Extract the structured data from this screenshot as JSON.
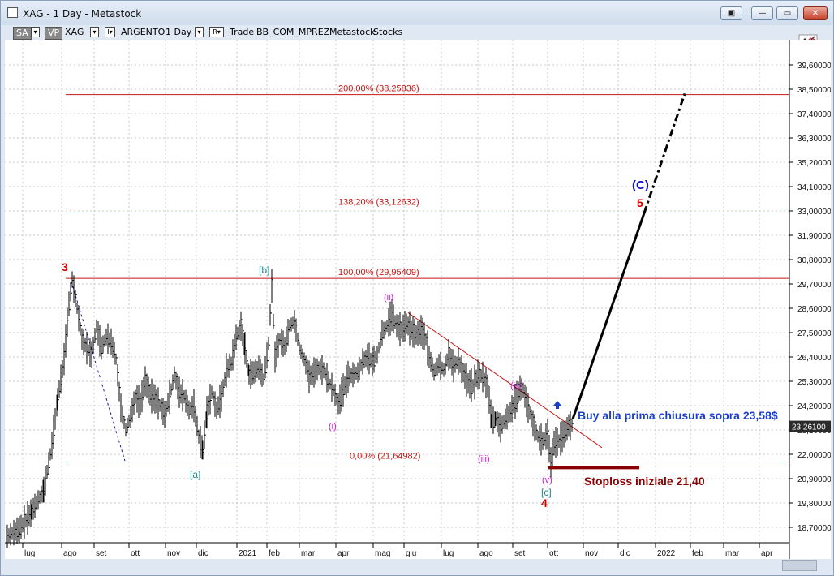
{
  "window": {
    "title": "XAG - 1 Day - Metastock",
    "buttons": {
      "options": "▣",
      "minimize": "—",
      "restore": "▭",
      "close": "✕"
    }
  },
  "toolbar": {
    "sa_label": "SA",
    "vp_label": "VP",
    "symbol": "XAG",
    "items": [
      "ARGENTO",
      "1 Day",
      "Trade",
      "BB_COM_MPREZ",
      "Metastock",
      "Stocks"
    ],
    "dropdown_glyph": "▾",
    "r_label": "R▾",
    "i_label": "I▾"
  },
  "icons": {
    "app": "window-icon",
    "toolbar_right": "chart-tools-icon"
  },
  "colors": {
    "price": "#000000",
    "fib": "#c81414",
    "wave_red": "#d00000",
    "wave_teal": "#208a8a",
    "wave_magenta": "#d020d0",
    "wave_blue": "#1010c0",
    "stoploss": "#8b0000",
    "last_price_bg": "#2b2b2b"
  },
  "chart_data": {
    "type": "line",
    "title": "XAG - 1 Day - Metastock",
    "price_axis_labels": [
      "39,60000",
      "38,50000",
      "37,40000",
      "36,30000",
      "35,20000",
      "34,10000",
      "33,00000",
      "31,90000",
      "30,80000",
      "29,70000",
      "28,60000",
      "27,50000",
      "26,40000",
      "25,30000",
      "24,20000",
      "23,10000",
      "22,00000",
      "20,90000",
      "19,80000",
      "18,70000"
    ],
    "last_price": "23,26100",
    "time_axis_labels": [
      "lug",
      "ago",
      "set",
      "ott",
      "nov",
      "dic",
      "2021",
      "feb",
      "mar",
      "apr",
      "mag",
      "giu",
      "lug",
      "ago",
      "set",
      "ott",
      "nov",
      "dic",
      "2022",
      "feb",
      "mar",
      "apr"
    ],
    "ylim": [
      18.0,
      40.5
    ],
    "fib_levels": [
      {
        "label": "200,00% (38,25836)",
        "value": 38.25836
      },
      {
        "label": "138,20% (33,12632)",
        "value": 33.12632
      },
      {
        "label": "100,00% (29,95409)",
        "value": 29.95409
      },
      {
        "label": "0,00% (21,64982)",
        "value": 21.64982
      }
    ],
    "price_path": [
      [
        0,
        18.3
      ],
      [
        15,
        18.6
      ],
      [
        30,
        19.4
      ],
      [
        45,
        20.4
      ],
      [
        55,
        22.4
      ],
      [
        62,
        24.5
      ],
      [
        70,
        26.3
      ],
      [
        76,
        28.8
      ],
      [
        80,
        29.9
      ],
      [
        86,
        28.6
      ],
      [
        92,
        27.2
      ],
      [
        98,
        26.8
      ],
      [
        104,
        26.5
      ],
      [
        110,
        27.8
      ],
      [
        116,
        26.8
      ],
      [
        122,
        27.3
      ],
      [
        128,
        27.1
      ],
      [
        134,
        26.3
      ],
      [
        140,
        24.1
      ],
      [
        146,
        23.1
      ],
      [
        152,
        23.7
      ],
      [
        158,
        24.6
      ],
      [
        164,
        24.3
      ],
      [
        170,
        25.3
      ],
      [
        176,
        24.7
      ],
      [
        182,
        24.5
      ],
      [
        188,
        24.2
      ],
      [
        194,
        23.8
      ],
      [
        200,
        24.6
      ],
      [
        206,
        25.6
      ],
      [
        212,
        24.8
      ],
      [
        218,
        24.6
      ],
      [
        224,
        24.0
      ],
      [
        230,
        24.2
      ],
      [
        236,
        22.8
      ],
      [
        241,
        22.2
      ],
      [
        246,
        23.9
      ],
      [
        252,
        24.8
      ],
      [
        258,
        24.0
      ],
      [
        264,
        24.6
      ],
      [
        270,
        25.8
      ],
      [
        276,
        26.1
      ],
      [
        282,
        27.3
      ],
      [
        288,
        27.8
      ],
      [
        293,
        26.8
      ],
      [
        298,
        25.6
      ],
      [
        304,
        25.7
      ],
      [
        310,
        25.9
      ],
      [
        316,
        25.4
      ],
      [
        322,
        27.0
      ],
      [
        326,
        29.6
      ],
      [
        330,
        26.4
      ],
      [
        336,
        27.2
      ],
      [
        342,
        26.9
      ],
      [
        348,
        27.8
      ],
      [
        354,
        28.0
      ],
      [
        360,
        26.8
      ],
      [
        366,
        26.3
      ],
      [
        372,
        25.5
      ],
      [
        378,
        25.7
      ],
      [
        384,
        25.9
      ],
      [
        390,
        25.8
      ],
      [
        396,
        25.3
      ],
      [
        402,
        24.9
      ],
      [
        408,
        24.3
      ],
      [
        414,
        24.9
      ],
      [
        420,
        25.5
      ],
      [
        426,
        25.6
      ],
      [
        432,
        25.7
      ],
      [
        438,
        26.2
      ],
      [
        444,
        26.4
      ],
      [
        450,
        26.2
      ],
      [
        456,
        26.5
      ],
      [
        462,
        27.5
      ],
      [
        468,
        27.8
      ],
      [
        474,
        28.3
      ],
      [
        480,
        27.8
      ],
      [
        486,
        27.6
      ],
      [
        492,
        27.9
      ],
      [
        498,
        27.6
      ],
      [
        504,
        27.4
      ],
      [
        510,
        27.6
      ],
      [
        516,
        27.2
      ],
      [
        520,
        26.4
      ],
      [
        526,
        25.7
      ],
      [
        532,
        26.1
      ],
      [
        538,
        25.8
      ],
      [
        544,
        26.5
      ],
      [
        550,
        26.0
      ],
      [
        556,
        26.2
      ],
      [
        562,
        25.7
      ],
      [
        568,
        25.2
      ],
      [
        574,
        25.1
      ],
      [
        580,
        25.6
      ],
      [
        586,
        25.5
      ],
      [
        592,
        25.1
      ],
      [
        597,
        23.5
      ],
      [
        602,
        23.6
      ],
      [
        608,
        23.2
      ],
      [
        614,
        23.6
      ],
      [
        620,
        23.9
      ],
      [
        626,
        24.4
      ],
      [
        632,
        25.0
      ],
      [
        636,
        24.9
      ],
      [
        642,
        24.1
      ],
      [
        648,
        23.4
      ],
      [
        654,
        22.8
      ],
      [
        660,
        22.6
      ],
      [
        666,
        22.9
      ],
      [
        670,
        21.6
      ],
      [
        674,
        22.5
      ],
      [
        680,
        22.6
      ],
      [
        686,
        22.9
      ],
      [
        692,
        23.3
      ],
      [
        696,
        23.3
      ]
    ],
    "trendline": [
      [
        497,
        28.4
      ],
      [
        736,
        22.3
      ]
    ],
    "projection_solid": [
      [
        700,
        23.6
      ],
      [
        788,
        32.9
      ]
    ],
    "projection_dashed": [
      [
        788,
        32.9
      ],
      [
        838,
        38.3
      ]
    ],
    "dashed_fall": [
      [
        82,
        29.8
      ],
      [
        148,
        21.7
      ]
    ],
    "stoploss_line": {
      "value": 21.4,
      "x_start": 670,
      "x_end": 782
    },
    "wave_labels": [
      {
        "text": "3",
        "color": "red"
      },
      {
        "text": "[b]",
        "color": "teal"
      },
      {
        "text": "[a]",
        "color": "teal"
      },
      {
        "text": "(ii)",
        "color": "magenta"
      },
      {
        "text": "(i)",
        "color": "magenta"
      },
      {
        "text": "(iv)",
        "color": "magenta"
      },
      {
        "text": "(iii)",
        "color": "magenta"
      },
      {
        "text": "(v)",
        "color": "magenta"
      },
      {
        "text": "[c]",
        "color": "teal"
      },
      {
        "text": "4",
        "color": "red"
      },
      {
        "text": "5",
        "color": "red"
      },
      {
        "text": "(C)",
        "color": "blue"
      }
    ],
    "annotations": {
      "buy": "Buy alla prima chiusura sopra 23,58$",
      "stoploss": "Stoploss iniziale 21,40",
      "arrow": "up-arrow"
    }
  }
}
